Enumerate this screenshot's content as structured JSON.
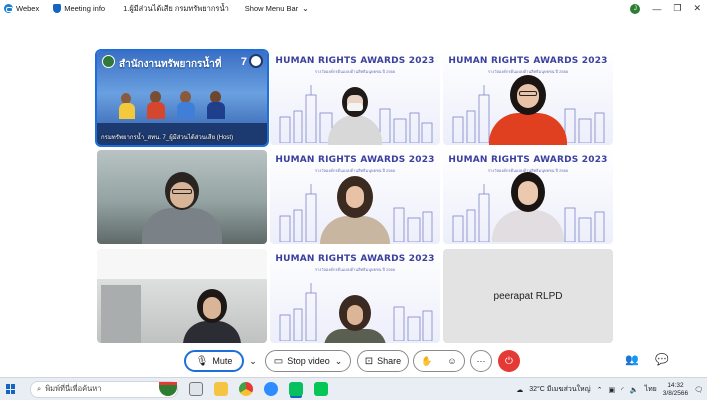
{
  "titlebar": {
    "app_name": "Webex",
    "meeting_info": "Meeting info",
    "meeting_title": "1.ผู้มีส่วนได้เสีย กรมทรัพยากรน้ำ",
    "show_menu_bar": "Show Menu Bar",
    "user_initial": "J",
    "minimize": "—",
    "maximize": "❐",
    "close": "✕"
  },
  "tiles": {
    "banner": {
      "title": "สำนักงานทรัพยากรน้ำที่",
      "number": "7",
      "caption": "กรมทรัพยากรน้ำ_สทน. 7_ผู้มีส่วนได้ส่วนเสีย (Host)"
    },
    "hra_title": "HUMAN RIGHTS AWARDS 2023",
    "hra_subtitle": "รางวัลองค์กรต้นแบบด้านสิทธิมนุษยชน ปี 2566",
    "placeholder_name": "peerapat RLPD"
  },
  "toolbar": {
    "mute_label": "Mute",
    "stop_video_label": "Stop video",
    "share_label": "Share",
    "more_label": "···"
  },
  "taskbar": {
    "search_placeholder": "พิมพ์ที่นี่เพื่อค้นหา",
    "weather": "32°C มีเมฆส่วนใหญ่",
    "language": "ไทย",
    "time": "14:32",
    "date": "3/8/2566"
  },
  "colors": {
    "accent": "#1e6fd9",
    "end_call": "#e53935",
    "hra_title": "#3b3f9e"
  }
}
